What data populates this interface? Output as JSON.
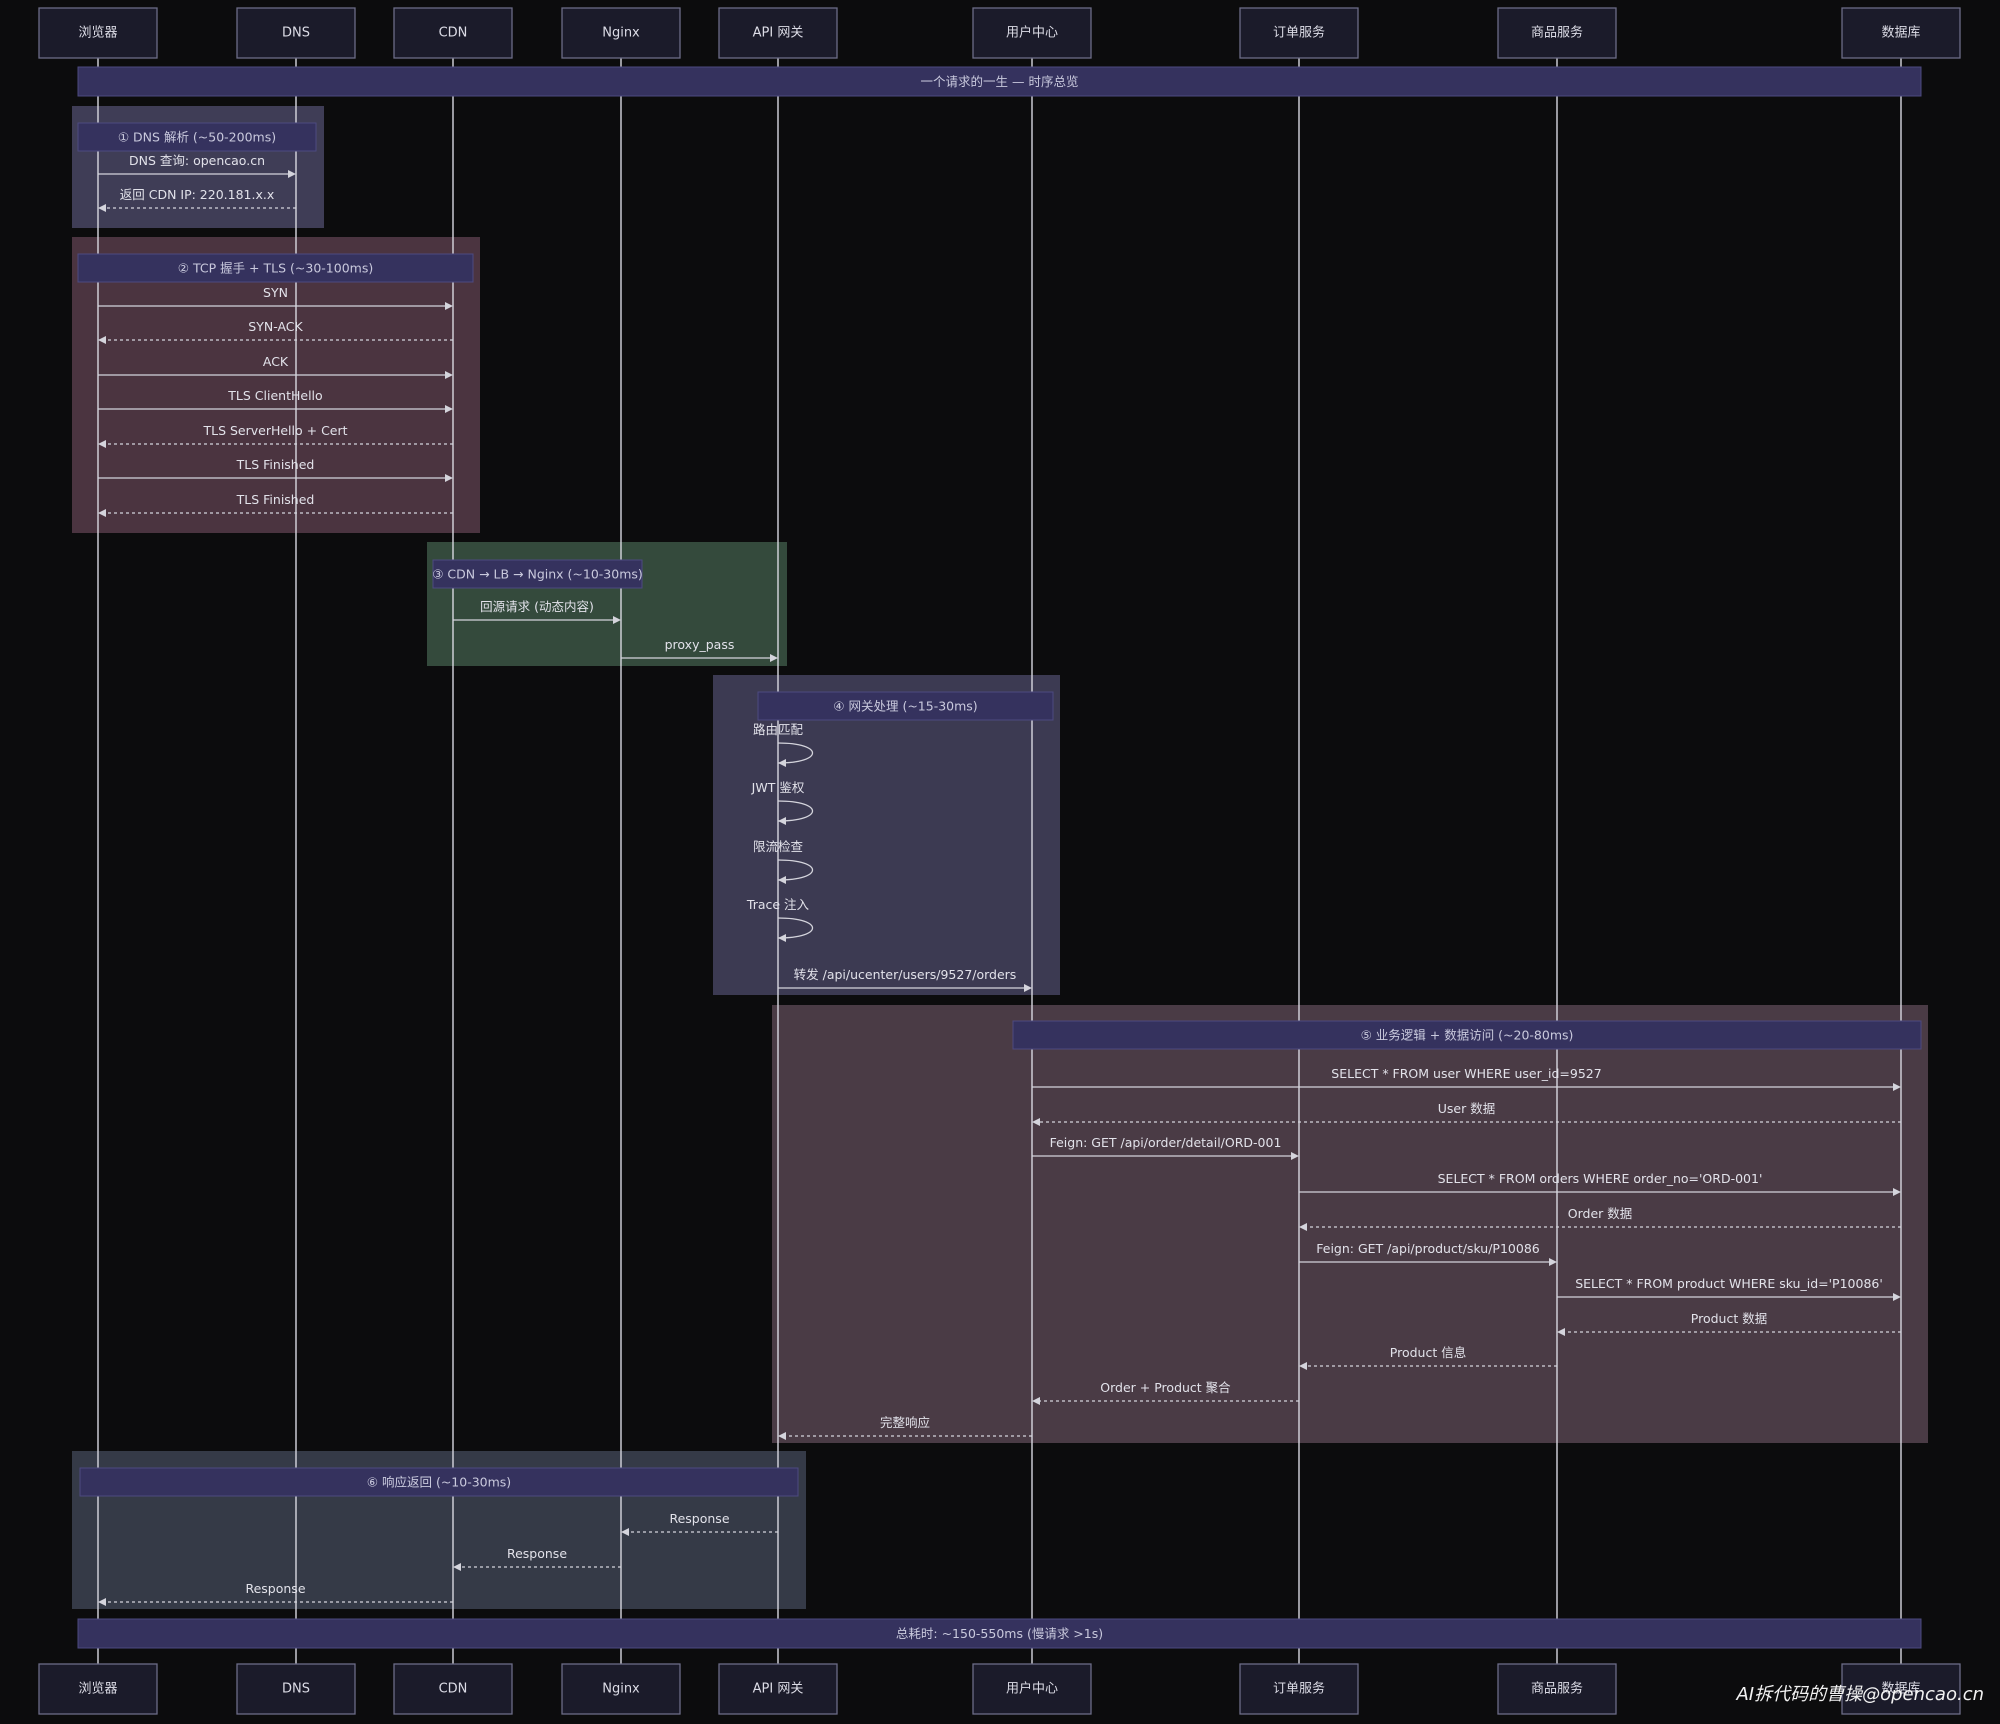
{
  "participants": [
    {
      "id": "browser",
      "label": "浏览器"
    },
    {
      "id": "dns",
      "label": "DNS"
    },
    {
      "id": "cdn",
      "label": "CDN"
    },
    {
      "id": "nginx",
      "label": "Nginx"
    },
    {
      "id": "gateway",
      "label": "API 网关"
    },
    {
      "id": "ucenter",
      "label": "用户中心"
    },
    {
      "id": "order",
      "label": "订单服务"
    },
    {
      "id": "product",
      "label": "商品服务"
    },
    {
      "id": "db",
      "label": "数据库"
    }
  ],
  "top_note": "一个请求的一生 — 时序总览",
  "bottom_note": "总耗时: ~150-550ms (慢请求 >1s)",
  "colors": {
    "dns": "#3f3d56",
    "tcp": "#4b3440",
    "nginx": "#344a3c",
    "gateway": "#3c3a52",
    "business": "#4a3b45",
    "response": "#353a47"
  },
  "phases": [
    {
      "id": "dns",
      "title": "① DNS 解析 (~50-200ms)",
      "color_key": "dns",
      "messages": [
        {
          "from": "browser",
          "to": "dns",
          "label": "DNS 查询: opencao.cn",
          "dashed": false
        },
        {
          "from": "dns",
          "to": "browser",
          "label": "返回 CDN IP: 220.181.x.x",
          "dashed": true
        }
      ]
    },
    {
      "id": "tcp",
      "title": "② TCP 握手 + TLS (~30-100ms)",
      "color_key": "tcp",
      "messages": [
        {
          "from": "browser",
          "to": "cdn",
          "label": "SYN",
          "dashed": false
        },
        {
          "from": "cdn",
          "to": "browser",
          "label": "SYN-ACK",
          "dashed": true
        },
        {
          "from": "browser",
          "to": "cdn",
          "label": "ACK",
          "dashed": false
        },
        {
          "from": "browser",
          "to": "cdn",
          "label": "TLS ClientHello",
          "dashed": false
        },
        {
          "from": "cdn",
          "to": "browser",
          "label": "TLS ServerHello + Cert",
          "dashed": true
        },
        {
          "from": "browser",
          "to": "cdn",
          "label": "TLS Finished",
          "dashed": false
        },
        {
          "from": "cdn",
          "to": "browser",
          "label": "TLS Finished",
          "dashed": true
        }
      ]
    },
    {
      "id": "nginx",
      "title": "③ CDN → LB → Nginx (~10-30ms)",
      "color_key": "nginx",
      "messages": [
        {
          "from": "cdn",
          "to": "nginx",
          "label": "回源请求 (动态内容)",
          "dashed": false
        },
        {
          "from": "nginx",
          "to": "gateway",
          "label": "proxy_pass",
          "dashed": false
        }
      ]
    },
    {
      "id": "gateway",
      "title": "④ 网关处理 (~15-30ms)",
      "color_key": "gateway",
      "messages": [
        {
          "from": "gateway",
          "to": "gateway",
          "label": "路由匹配",
          "dashed": false
        },
        {
          "from": "gateway",
          "to": "gateway",
          "label": "JWT 鉴权",
          "dashed": false
        },
        {
          "from": "gateway",
          "to": "gateway",
          "label": "限流检查",
          "dashed": false
        },
        {
          "from": "gateway",
          "to": "gateway",
          "label": "Trace 注入",
          "dashed": false
        },
        {
          "from": "gateway",
          "to": "ucenter",
          "label": "转发 /api/ucenter/users/9527/orders",
          "dashed": false
        }
      ]
    },
    {
      "id": "business",
      "title": "⑤ 业务逻辑 + 数据访问 (~20-80ms)",
      "color_key": "business",
      "messages": [
        {
          "from": "ucenter",
          "to": "db",
          "label": "SELECT * FROM user WHERE user_id=9527",
          "dashed": false
        },
        {
          "from": "db",
          "to": "ucenter",
          "label": "User 数据",
          "dashed": true
        },
        {
          "from": "ucenter",
          "to": "order",
          "label": "Feign: GET /api/order/detail/ORD-001",
          "dashed": false
        },
        {
          "from": "order",
          "to": "db",
          "label": "SELECT * FROM orders WHERE order_no='ORD-001'",
          "dashed": false
        },
        {
          "from": "db",
          "to": "order",
          "label": "Order 数据",
          "dashed": true
        },
        {
          "from": "order",
          "to": "product",
          "label": "Feign: GET /api/product/sku/P10086",
          "dashed": false
        },
        {
          "from": "product",
          "to": "db",
          "label": "SELECT * FROM product WHERE sku_id='P10086'",
          "dashed": false
        },
        {
          "from": "db",
          "to": "product",
          "label": "Product 数据",
          "dashed": true
        },
        {
          "from": "product",
          "to": "order",
          "label": "Product 信息",
          "dashed": true
        },
        {
          "from": "order",
          "to": "ucenter",
          "label": "Order + Product 聚合",
          "dashed": true
        },
        {
          "from": "ucenter",
          "to": "gateway",
          "label": "完整响应",
          "dashed": true
        }
      ]
    },
    {
      "id": "response",
      "title": "⑥ 响应返回 (~10-30ms)",
      "color_key": "response",
      "messages": [
        {
          "from": "gateway",
          "to": "nginx",
          "label": "Response",
          "dashed": true
        },
        {
          "from": "nginx",
          "to": "cdn",
          "label": "Response",
          "dashed": true
        },
        {
          "from": "cdn",
          "to": "browser",
          "label": "Response",
          "dashed": true
        }
      ]
    }
  ],
  "watermark": "AI拆代码的曹操@opencao.cn"
}
